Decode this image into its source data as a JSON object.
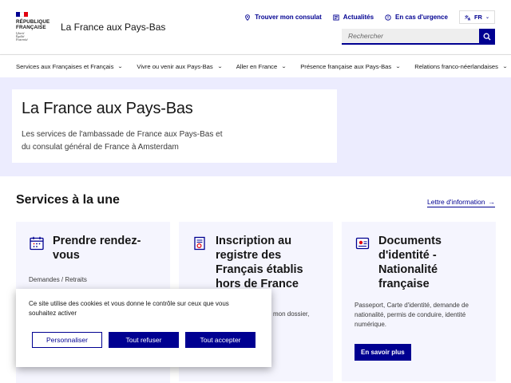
{
  "header": {
    "logo": {
      "title_line1": "RÉPUBLIQUE",
      "title_line2": "FRANÇAISE",
      "motto_line1": "Liberté",
      "motto_line2": "Égalité",
      "motto_line3": "Fraternité"
    },
    "site_title": "La France aux Pays-Bas",
    "links": {
      "consulate": "Trouver mon consulat",
      "news": "Actualités",
      "emergency": "En cas d'urgence"
    },
    "lang": "FR",
    "search": {
      "placeholder": "Rechercher"
    }
  },
  "nav": [
    {
      "label": "Services aux Françaises et Français"
    },
    {
      "label": "Vivre ou venir aux Pays-Bas"
    },
    {
      "label": "Aller en France"
    },
    {
      "label": "Présence française aux Pays-Bas"
    },
    {
      "label": "Relations franco-néerlandaises"
    }
  ],
  "hero": {
    "title": "La France aux Pays-Bas",
    "desc": "Les services de l'ambassade de France aux Pays-Bas et du consulat général de France à Amsterdam"
  },
  "services": {
    "title": "Services à la une",
    "newsletter": "Lettre d'information",
    "cards": [
      {
        "title": "Prendre rendez-vous",
        "desc": "Demandes / Retraits",
        "icon": "calendar-icon"
      },
      {
        "title": "Inscription au registre des Français établis hors de France",
        "desc": "mon dossier,",
        "icon": "document-icon"
      },
      {
        "title": "Documents d'identité - Nationalité française",
        "desc": "Passeport, Carte d'identité, demande de nationalité, permis de conduire, identité numérique.",
        "button": "En savoir plus",
        "icon": "id-card-icon"
      }
    ]
  },
  "cookie": {
    "text": "Ce site utilise des cookies et vous donne le contrôle sur ceux que vous souhaitez activer",
    "customize": "Personnaliser",
    "refuse": "Tout refuser",
    "accept": "Tout accepter"
  },
  "colors": {
    "primary": "#000091",
    "hero_bg": "#ececfe",
    "card_bg": "#f5f5fe",
    "red": "#e1000f"
  }
}
